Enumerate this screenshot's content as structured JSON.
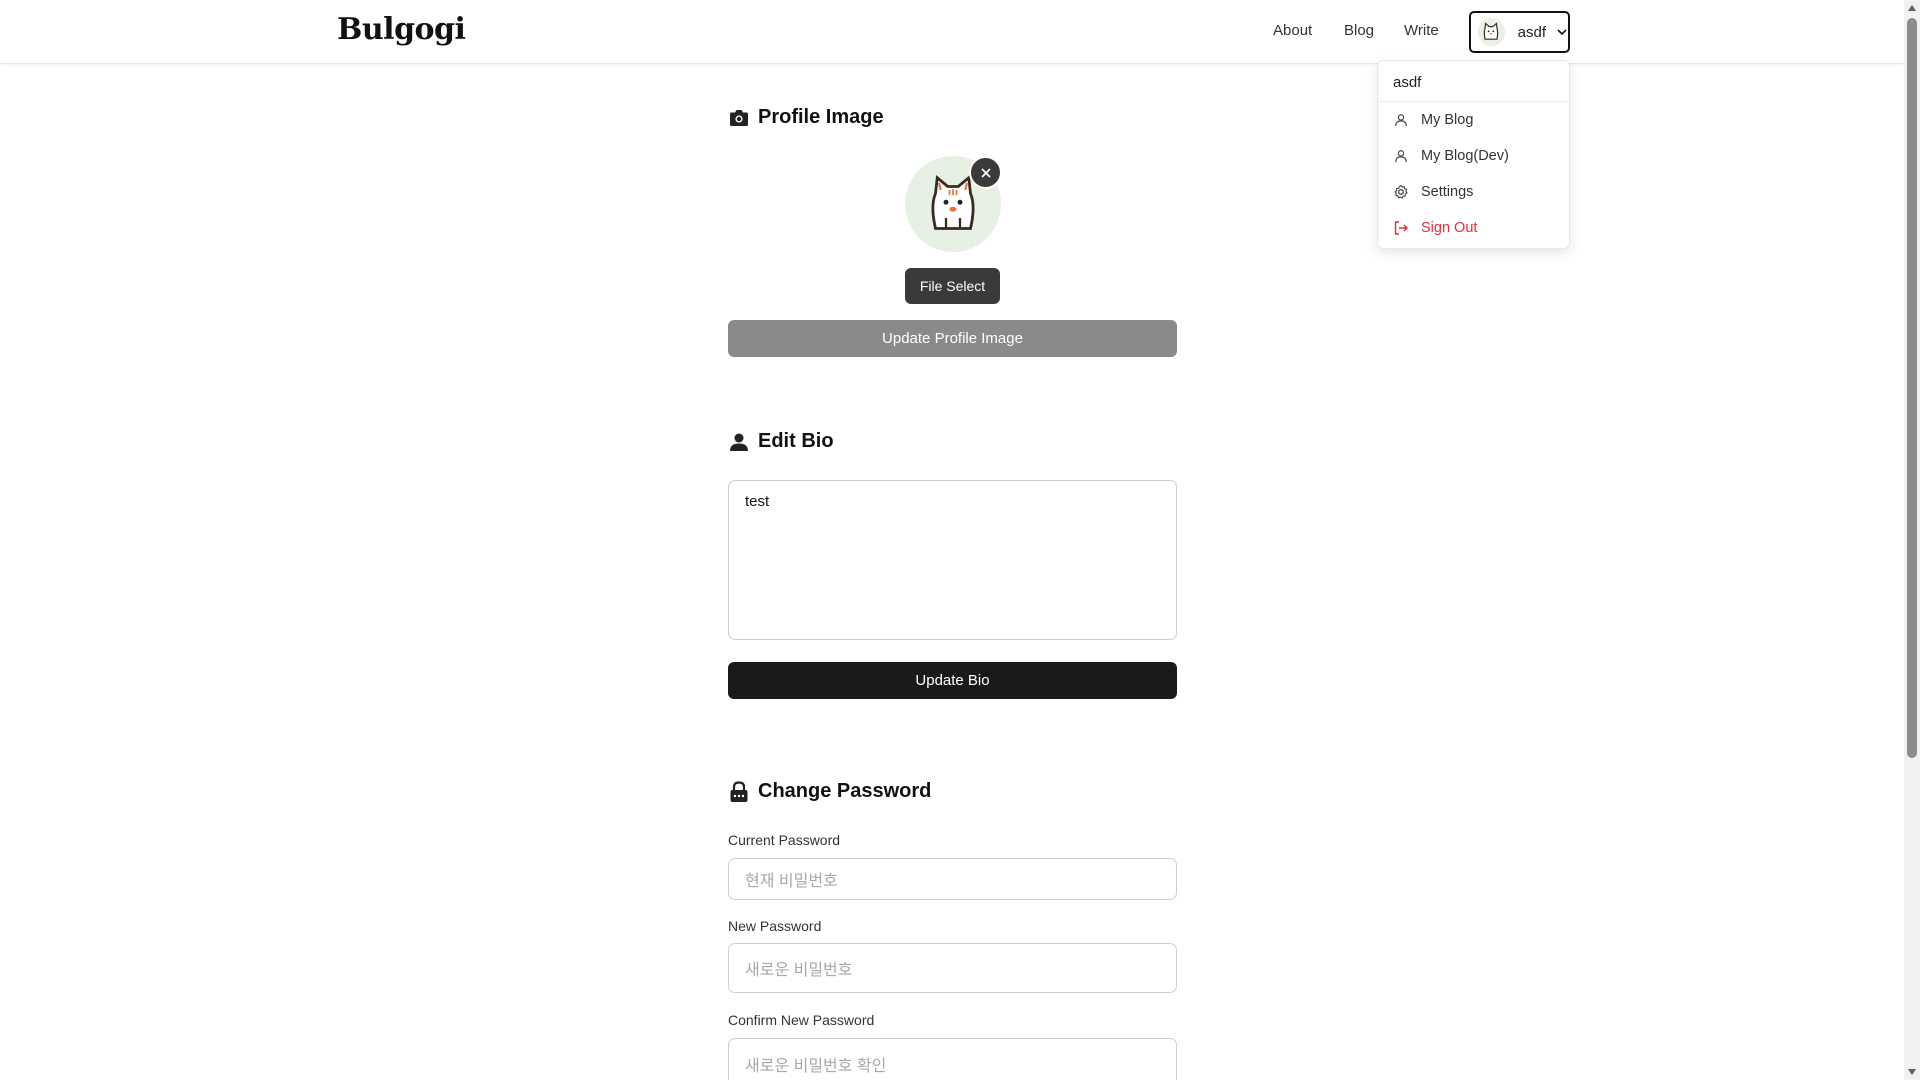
{
  "header": {
    "logo": "Bulgogi",
    "nav": {
      "about": "About",
      "blog": "Blog",
      "write": "Write"
    },
    "user": {
      "name": "asdf"
    }
  },
  "dropdown": {
    "username": "asdf",
    "items": [
      {
        "label": "My Blog",
        "icon": "user-icon"
      },
      {
        "label": "My Blog(Dev)",
        "icon": "user-icon"
      },
      {
        "label": "Settings",
        "icon": "gear-icon"
      },
      {
        "label": "Sign Out",
        "icon": "sign-out-icon"
      }
    ]
  },
  "profile_image": {
    "title": "Profile Image",
    "file_select": "File Select",
    "update_button": "Update Profile Image"
  },
  "bio": {
    "title": "Edit Bio",
    "value": "test",
    "update_button": "Update Bio"
  },
  "password": {
    "title": "Change Password",
    "current_label": "Current Password",
    "current_placeholder": "현재 비밀번호",
    "new_label": "New Password",
    "new_placeholder": "새로운 비밀번호",
    "confirm_label": "Confirm New Password",
    "confirm_placeholder": "새로운 비밀번호 확인"
  },
  "colors": {
    "accent_dark": "#1a1a1a",
    "disabled_button": "#8a8a8a",
    "sign_out": "#e0313b",
    "avatar_bg": "#e6f1e3"
  }
}
